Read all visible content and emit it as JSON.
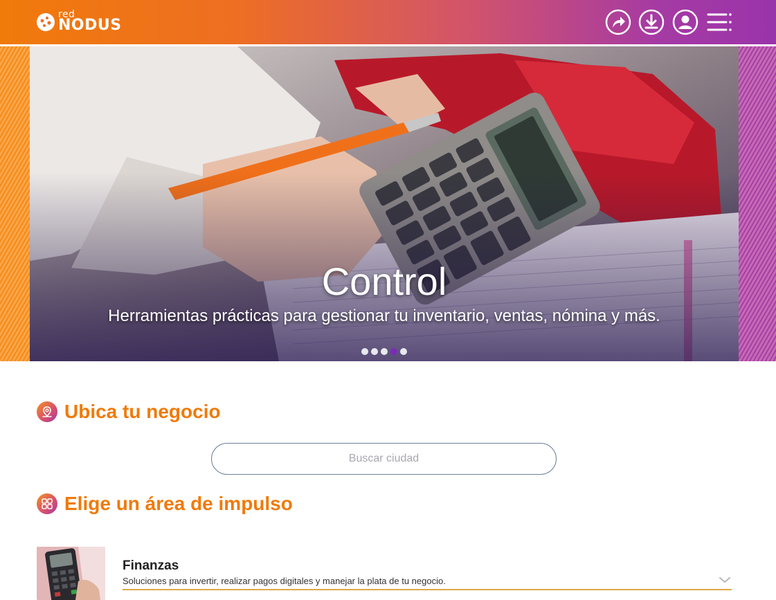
{
  "brand": {
    "logo_small": "red",
    "logo_big": "NODUS"
  },
  "header": {
    "icons": [
      "share-icon",
      "download-icon",
      "user-icon",
      "menu-icon"
    ]
  },
  "hero": {
    "title": "Control",
    "subtitle": "Herramientas prácticas para gestionar tu inventario, ventas, nómina y más.",
    "slides_count": 5,
    "active_slide": 4
  },
  "locate": {
    "title": "Ubica tu negocio",
    "search_placeholder": "Buscar ciudad"
  },
  "areas": {
    "title": "Elige un área de impulso",
    "items": [
      {
        "title": "Finanzas",
        "description": "Soluciones para invertir, realizar pagos digitales y manejar la plata de tu negocio."
      }
    ]
  },
  "colors": {
    "accent_orange": "#f07a0a",
    "accent_purple": "#9a34aa",
    "active_dot": "#7a2bb8"
  }
}
